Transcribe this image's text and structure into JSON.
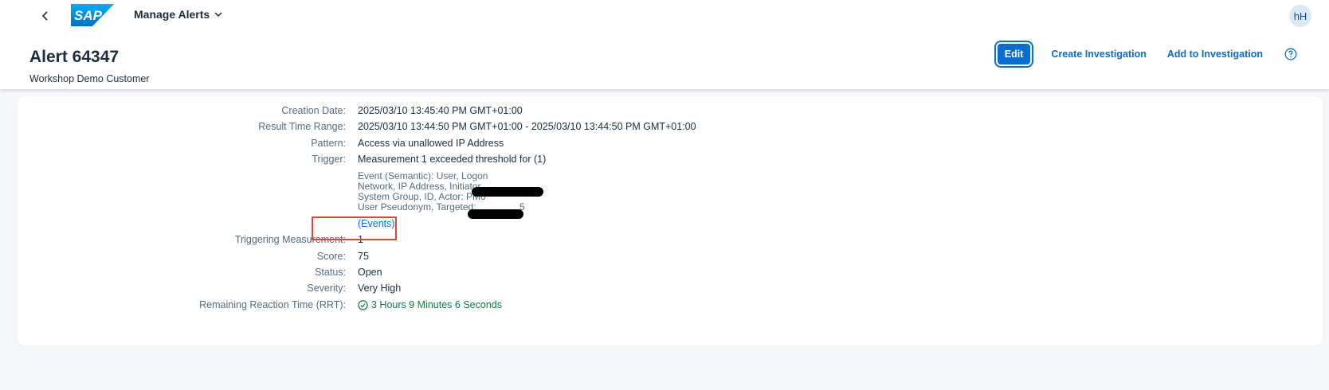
{
  "shell": {
    "app_title": "Manage Alerts",
    "logo_text": "SAP",
    "avatar_initials": "hH"
  },
  "header": {
    "title": "Alert 64347",
    "subtitle": "Workshop Demo Customer",
    "actions": {
      "edit": "Edit",
      "create_investigation": "Create Investigation",
      "add_to_investigation": "Add to Investigation"
    }
  },
  "details": {
    "creation_date": {
      "label": "Creation Date:",
      "value": "2025/03/10 13:45:40 PM GMT+01:00"
    },
    "result_time_range": {
      "label": "Result Time Range:",
      "value": "2025/03/10 13:44:50 PM GMT+01:00 - 2025/03/10 13:44:50 PM GMT+01:00"
    },
    "pattern": {
      "label": "Pattern:",
      "value": "Access via unallowed IP Address"
    },
    "trigger": {
      "label": "Trigger:",
      "value": "Measurement 1 exceeded threshold for (1)",
      "lines": [
        "Event (Semantic): User, Logon",
        "Network, IP Address, Initiator",
        "System Group, ID, Actor: PM0",
        "User Pseudonym, Targeted:",
        "5"
      ],
      "events_link": "(Events)"
    },
    "triggering_measurement": {
      "label": "Triggering Measurement:",
      "value": "1"
    },
    "score": {
      "label": "Score:",
      "value": "75"
    },
    "status": {
      "label": "Status:",
      "value": "Open"
    },
    "severity": {
      "label": "Severity:",
      "value": "Very High"
    },
    "rrt": {
      "label": "Remaining Reaction Time (RRT):",
      "value": "3 Hours 9 Minutes 6 Seconds"
    }
  },
  "colors": {
    "brand_blue": "#0a6ed1",
    "positive_green": "#107e3e",
    "highlight_red": "#e8403a"
  }
}
